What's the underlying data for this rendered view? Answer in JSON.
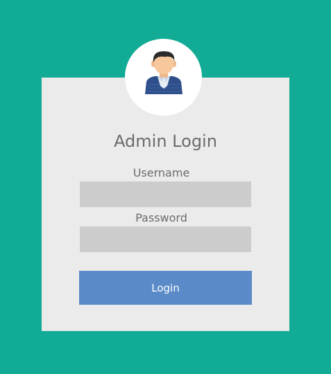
{
  "login_form": {
    "title": "Admin Login",
    "username_label": "Username",
    "username_value": "",
    "password_label": "Password",
    "password_value": "",
    "submit_label": "Login"
  },
  "avatar": {
    "icon": "admin-user-icon"
  },
  "colors": {
    "page_background": "#12ab95",
    "card_background": "#ebebeb",
    "input_background": "#cccccc",
    "button_background": "#5a8bc8",
    "text": "#6b6b6b"
  }
}
